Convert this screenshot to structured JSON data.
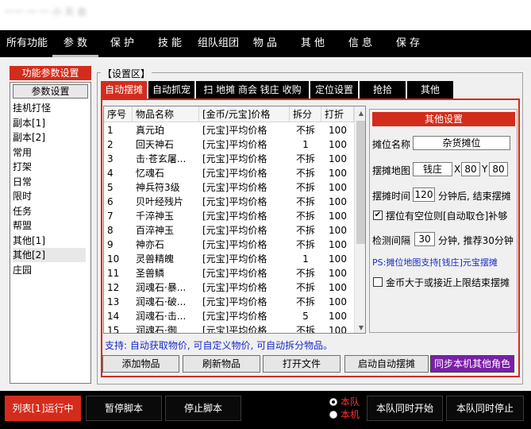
{
  "window": {
    "title": "一一 一 一 小 天 会"
  },
  "menu": [
    "所有功能",
    "参 数",
    "保 护",
    "技 能",
    "组队组团",
    "物 品",
    "其 他",
    "信 息",
    "保 存"
  ],
  "left": {
    "header": "功能参数设置",
    "button": "参数设置",
    "items": [
      "挂机打怪",
      "副本[1]",
      "副本[2]",
      "常用",
      "打架",
      "日常",
      "限时",
      "任务",
      "帮盟",
      "其他[1]",
      "其他[2]",
      "庄园"
    ],
    "selected_index": 10
  },
  "settings_group_label": "【设置区】",
  "tabs": [
    "自动摆摊",
    "自动抓宠",
    "扫 地摊 商会 钱庄 收购",
    "定位设置",
    "抢拾",
    "其他"
  ],
  "table": {
    "columns": [
      "序号",
      "物品名称",
      "[金币/元宝]价格",
      "拆分",
      "打折"
    ],
    "rows": [
      [
        "1",
        "真元珀",
        "[元宝]平均价格",
        "不拆",
        "100"
      ],
      [
        "2",
        "回天神石",
        "[元宝]平均价格",
        "1",
        "100"
      ],
      [
        "3",
        "击·苍玄屠...",
        "[元宝]平均价格",
        "不拆",
        "100"
      ],
      [
        "4",
        "忆魂石",
        "[元宝]平均价格",
        "不拆",
        "100"
      ],
      [
        "5",
        "神兵符3级",
        "[元宝]平均价格",
        "不拆",
        "100"
      ],
      [
        "6",
        "贝叶经残片",
        "[元宝]平均价格",
        "不拆",
        "100"
      ],
      [
        "7",
        "千淬神玉",
        "[元宝]平均价格",
        "不拆",
        "100"
      ],
      [
        "8",
        "百淬神玉",
        "[元宝]平均价格",
        "不拆",
        "100"
      ],
      [
        "9",
        "神亦石",
        "[元宝]平均价格",
        "不拆",
        "100"
      ],
      [
        "10",
        "灵兽精魄",
        "[元宝]平均价格",
        "1",
        "100"
      ],
      [
        "11",
        "圣兽鳞",
        "[元宝]平均价格",
        "不拆",
        "100"
      ],
      [
        "12",
        "润魂石·暴...",
        "[元宝]平均价格",
        "不拆",
        "100"
      ],
      [
        "13",
        "润魂石·破...",
        "[元宝]平均价格",
        "不拆",
        "100"
      ],
      [
        "14",
        "润魂石·击...",
        "[元宝]平均价格",
        "5",
        "100"
      ],
      [
        "15",
        "润魂石·御",
        "[元宝]平均价格",
        "不拆",
        "100"
      ]
    ]
  },
  "other": {
    "header": "其他设置",
    "stall_name_label": "摊位名称",
    "stall_name_value": "杂货摊位",
    "map_label": "摆摊地图",
    "map_value": "钱庄",
    "x_label": "X",
    "x_value": "80",
    "y_label": "Y",
    "y_value": "80",
    "time_label": "摆摊时间",
    "time_value": "120",
    "time_suffix": "分钟后, 结束摆摊",
    "auto_fetch_checked": true,
    "auto_fetch_label": "摆位有空位则[自动取仓]补够",
    "interval_label": "检测间隔",
    "interval_value": "30",
    "interval_suffix": "分钟, 推荐30分钟",
    "ps_note": "PS:摊位地图支持[钱庄]元宝摆摊",
    "gold_limit_checked": false,
    "gold_limit_label": "金币大于或接近上限结束摆摊"
  },
  "support_text": "支持: 自动获取物价, 可自定义物价, 可自动拆分物品。",
  "buttons": {
    "add_item": "添加物品",
    "refresh_item": "刷新物品",
    "open_file": "打开文件",
    "start_auto": "启动自动摆摊",
    "sync_roles": "同步本机其他角色"
  },
  "bottom": {
    "status": "列表[1]运行中",
    "pause": "暂停脚本",
    "stop": "停止脚本",
    "radio_team": "本队",
    "radio_machine": "本机",
    "team_start": "本队同时开始",
    "team_stop": "本队同时停止"
  },
  "colors": {
    "accent_red": "#d42c1c",
    "sync_button": "#7a1fa8",
    "link_blue": "#1a2bc8"
  }
}
